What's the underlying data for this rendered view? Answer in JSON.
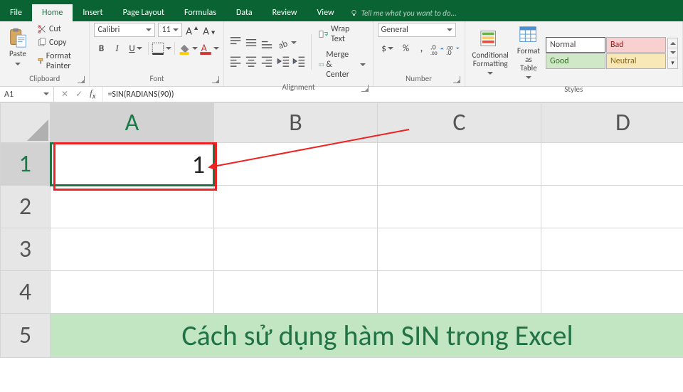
{
  "tabs": {
    "file": "File",
    "home": "Home",
    "insert": "Insert",
    "page_layout": "Page Layout",
    "formulas": "Formulas",
    "data": "Data",
    "review": "Review",
    "view": "View",
    "tell_me": "Tell me what you want to do..."
  },
  "clipboard": {
    "paste": "Paste",
    "cut": "Cut",
    "copy": "Copy",
    "format_painter": "Format Painter",
    "group": "Clipboard"
  },
  "font": {
    "name": "Calibri",
    "size": "11",
    "group": "Font"
  },
  "alignment": {
    "wrap": "Wrap Text",
    "merge": "Merge & Center",
    "group": "Alignment"
  },
  "number": {
    "format": "General",
    "group": "Number"
  },
  "cond": {
    "conditional": "Conditional\nFormatting",
    "format_table": "Format as\nTable"
  },
  "styles": {
    "normal": "Normal",
    "bad": "Bad",
    "good": "Good",
    "neutral": "Neutral",
    "group": "Styles"
  },
  "namebox": "A1",
  "formula": "=SIN(RADIANS(90))",
  "columns": [
    "A",
    "B",
    "C",
    "D"
  ],
  "rows": [
    "1",
    "2",
    "3",
    "4",
    "5"
  ],
  "cell_a1": "1",
  "banner": "Cách sử dụng hàm SIN trong Excel"
}
